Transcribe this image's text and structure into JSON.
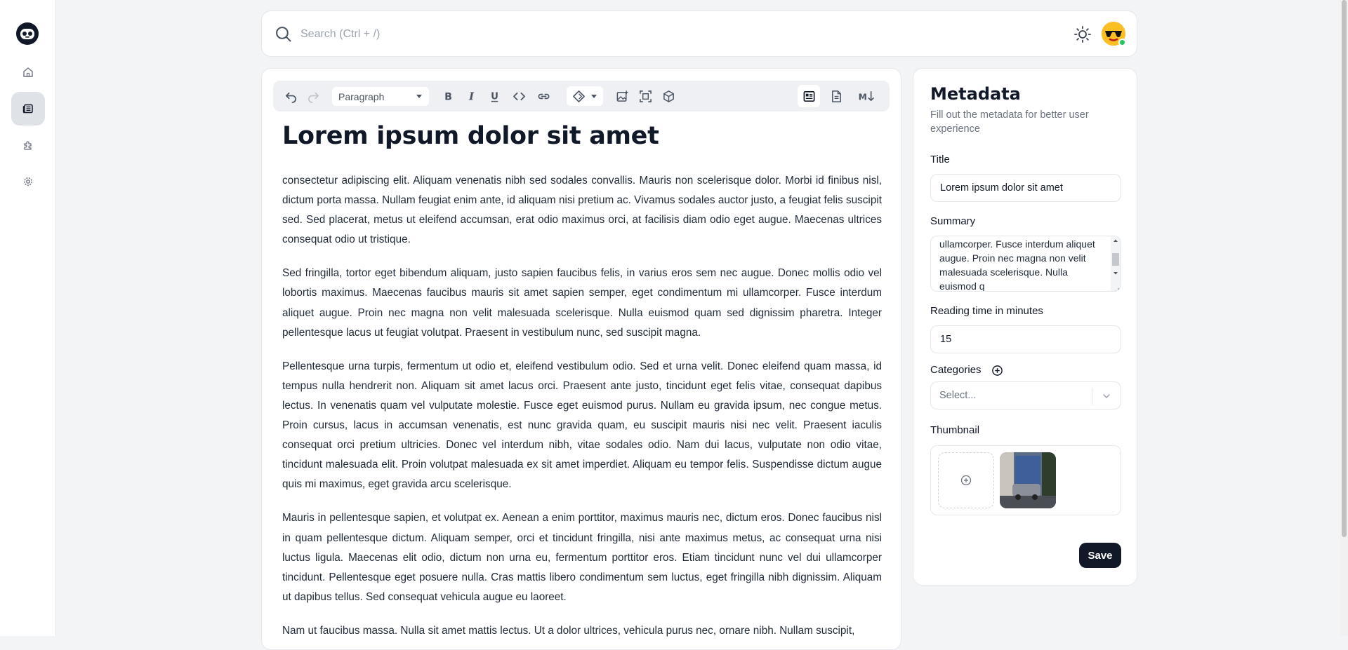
{
  "sidebar": {
    "logo": "robot-face-logo",
    "items": [
      {
        "icon": "home-icon",
        "name": "home"
      },
      {
        "icon": "newspaper-icon",
        "name": "posts",
        "active": true
      },
      {
        "icon": "puzzle-icon",
        "name": "extensions"
      },
      {
        "icon": "gear-icon",
        "name": "settings"
      }
    ]
  },
  "topbar": {
    "search_placeholder": "Search (Ctrl + /)",
    "theme_icon": "sun-icon",
    "avatar_status_color": "#22c55e"
  },
  "toolbar": {
    "block_type": "Paragraph",
    "buttons": [
      "undo",
      "redo",
      "bold",
      "italic",
      "underline",
      "code",
      "link",
      "ai-diamond",
      "image",
      "embed",
      "block",
      "visual-mode",
      "source-mode",
      "markdown-mode"
    ],
    "active_mode": "visual-mode"
  },
  "document": {
    "title": "Lorem ipsum dolor sit amet",
    "paragraphs": [
      "consectetur adipiscing elit. Aliquam venenatis nibh sed sodales convallis. Mauris non scelerisque dolor. Morbi id finibus nisl, dictum porta massa. Nullam feugiat enim ante, id aliquam nisi pretium ac. Vivamus sodales auctor justo, a feugiat felis suscipit sed. Sed placerat, metus ut eleifend accumsan, erat odio maximus orci, at facilisis diam odio eget augue. Maecenas ultrices consequat odio ut tristique.",
      "Sed fringilla, tortor eget bibendum aliquam, justo sapien faucibus felis, in varius eros sem nec augue. Donec mollis odio vel lobortis maximus. Maecenas faucibus mauris sit amet sapien semper, eget condimentum mi ullamcorper. Fusce interdum aliquet augue. Proin nec magna non velit malesuada scelerisque. Nulla euismod quam sed dignissim pharetra. Integer pellentesque lacus ut feugiat volutpat. Praesent in vestibulum nunc, sed suscipit magna.",
      "Pellentesque urna turpis, fermentum ut odio et, eleifend vestibulum odio. Sed et urna velit. Donec eleifend quam massa, id tempus nulla hendrerit non. Aliquam sit amet lacus orci. Praesent ante justo, tincidunt eget felis vitae, consequat dapibus lectus. In venenatis quam vel vulputate molestie. Fusce eget euismod purus. Nullam eu gravida ipsum, nec congue metus. Proin cursus, lacus in accumsan venenatis, est nunc gravida quam, eu suscipit mauris nisi nec velit. Praesent iaculis consequat orci pretium ultricies. Donec vel interdum nibh, vitae sodales odio. Nam dui lacus, vulputate non odio vitae, tincidunt malesuada elit. Proin volutpat malesuada ex sit amet imperdiet. Aliquam eu tempor felis. Suspendisse dictum augue quis mi maximus, eget gravida arcu scelerisque.",
      "Mauris in pellentesque sapien, et volutpat ex. Aenean a enim porttitor, maximus mauris nec, dictum eros. Donec faucibus nisl in quam pellentesque dictum. Aliquam semper, orci et tincidunt fringilla, nisi ante maximus metus, ac consequat urna nisi luctus ligula. Maecenas elit odio, dictum non urna eu, fermentum porttitor eros. Etiam tincidunt nunc vel dui ullamcorper tincidunt. Pellentesque eget posuere nulla. Cras mattis libero condimentum sem luctus, eget fringilla nibh dignissim. Aliquam ut dapibus tellus. Sed consequat vehicula augue eu laoreet.",
      "Nam ut faucibus massa. Nulla sit amet mattis lectus. Ut a dolor ultrices, vehicula purus nec, ornare nibh. Nullam suscipit,"
    ]
  },
  "metadata": {
    "heading": "Metadata",
    "subheading": "Fill out the metadata for better user experience",
    "title_label": "Title",
    "title_value": "Lorem ipsum dolor sit amet",
    "summary_label": "Summary",
    "summary_visible": "ullamcorper. Fusce interdum aliquet augue. Proin nec magna non velit malesuada scelerisque. Nulla euismod q",
    "reading_time_label": "Reading time in minutes",
    "reading_time_value": "15",
    "categories_label": "Categories",
    "categories_placeholder": "Select...",
    "thumbnail_label": "Thumbnail",
    "save_label": "Save"
  }
}
